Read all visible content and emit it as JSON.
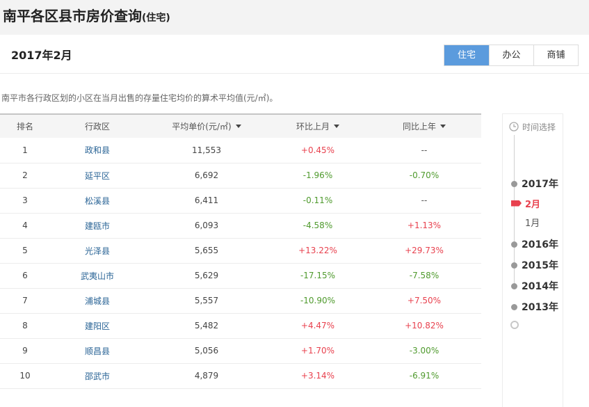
{
  "title": {
    "main": "南平各区县市房价查询",
    "sub": "(住宅)"
  },
  "period": "2017年2月",
  "tabs": [
    {
      "label": "住宅",
      "active": true
    },
    {
      "label": "办公",
      "active": false
    },
    {
      "label": "商铺",
      "active": false
    }
  ],
  "description": "南平市各行政区划的小区在当月出售的存量住宅均价的算术平均值(元/㎡)。",
  "table": {
    "headers": {
      "rank": "排名",
      "district": "行政区",
      "price": "平均单价(元/㎡)",
      "mom": "环比上月",
      "yoy": "同比上年"
    },
    "rows": [
      {
        "rank": "1",
        "district": "政和县",
        "price": "11,553",
        "mom": "+0.45%",
        "yoy": "--"
      },
      {
        "rank": "2",
        "district": "延平区",
        "price": "6,692",
        "mom": "-1.96%",
        "yoy": "-0.70%"
      },
      {
        "rank": "3",
        "district": "松溪县",
        "price": "6,411",
        "mom": "-0.11%",
        "yoy": "--"
      },
      {
        "rank": "4",
        "district": "建瓯市",
        "price": "6,093",
        "mom": "-4.58%",
        "yoy": "+1.13%"
      },
      {
        "rank": "5",
        "district": "光泽县",
        "price": "5,655",
        "mom": "+13.22%",
        "yoy": "+29.73%"
      },
      {
        "rank": "6",
        "district": "武夷山市",
        "price": "5,629",
        "mom": "-17.15%",
        "yoy": "-7.58%"
      },
      {
        "rank": "7",
        "district": "浦城县",
        "price": "5,557",
        "mom": "-10.90%",
        "yoy": "+7.50%"
      },
      {
        "rank": "8",
        "district": "建阳区",
        "price": "5,482",
        "mom": "+4.47%",
        "yoy": "+10.82%"
      },
      {
        "rank": "9",
        "district": "顺昌县",
        "price": "5,056",
        "mom": "+1.70%",
        "yoy": "-3.00%"
      },
      {
        "rank": "10",
        "district": "邵武市",
        "price": "4,879",
        "mom": "+3.14%",
        "yoy": "-6.91%"
      }
    ]
  },
  "time_selector": {
    "label": "时间选择",
    "items": [
      {
        "kind": "year",
        "text": "2017年"
      },
      {
        "kind": "month",
        "text": "2月",
        "active": true
      },
      {
        "kind": "month",
        "text": "1月",
        "active": false
      },
      {
        "kind": "year",
        "text": "2016年"
      },
      {
        "kind": "year",
        "text": "2015年"
      },
      {
        "kind": "year",
        "text": "2014年"
      },
      {
        "kind": "year",
        "text": "2013年"
      }
    ]
  },
  "colors": {
    "accent": "#5b9bdd",
    "up": "#e8414e",
    "down": "#4f9a2d",
    "link": "#2a6496"
  }
}
